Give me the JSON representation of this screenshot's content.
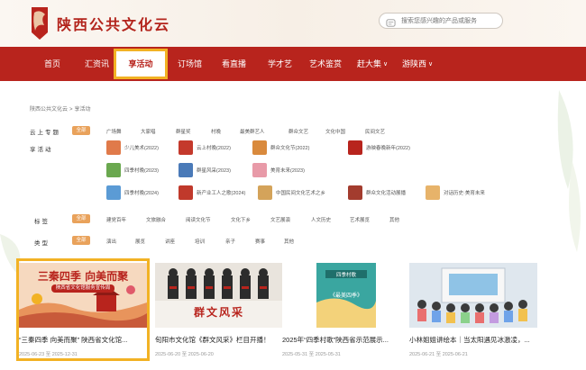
{
  "header": {
    "site_title": "陕西公共文化云",
    "logo_text": "陕西文化云",
    "search_placeholder": "搜索您感兴趣的产品或服务"
  },
  "nav": {
    "items": [
      {
        "label": "首页"
      },
      {
        "label": "汇资讯"
      },
      {
        "label": "享活动",
        "active": true
      },
      {
        "label": "订场馆"
      },
      {
        "label": "看直播"
      },
      {
        "label": "学才艺"
      },
      {
        "label": "艺术鉴赏"
      },
      {
        "label": "赶大集",
        "dropdown": true
      },
      {
        "label": "游陕西",
        "dropdown": true
      }
    ]
  },
  "breadcrumb": {
    "home": "陕西公共文化云",
    "sep": ">",
    "current": "享活动"
  },
  "filters": {
    "yunshang": {
      "label": "云上专题",
      "all": "全部",
      "options": [
        "广场舞",
        "大家唱",
        "群星奖",
        "村晚",
        "最美群艺人",
        "群众文艺",
        "文化中国",
        "民间文艺"
      ]
    },
    "xiang": {
      "label": "享活动",
      "activities": [
        {
          "label": "少儿美术(2022)",
          "color": "#e07a4a"
        },
        {
          "label": "云上村晚(2022)",
          "color": "#c4392c"
        },
        {
          "label": "群众文化节(2022)",
          "color": "#d98a3d"
        },
        {
          "label": "游映春晚新年(2022)",
          "color": "#b8241d"
        },
        {
          "label": "四季村晚(2023)",
          "color": "#6aa84f"
        },
        {
          "label": "群星风采(2023)",
          "color": "#4a7ab8"
        },
        {
          "label": "美育未来(2023)",
          "color": "#e89aa8"
        },
        {
          "label": "四季村晚(2024)",
          "color": "#5b9bd5"
        },
        {
          "label": "新产业工人之歌(2024)",
          "color": "#c0392b"
        },
        {
          "label": "中国民间文化艺术之乡",
          "color": "#d4a35a"
        },
        {
          "label": "群众文化活动展播",
          "color": "#a33c2e"
        },
        {
          "label": "对话历史·美育未来",
          "color": "#e7b36a"
        }
      ]
    },
    "tags": {
      "label": "标签",
      "all": "全部",
      "options": [
        "建党百年",
        "文旅融合",
        "阅读文化节",
        "文化下乡",
        "文艺展演",
        "人文历史",
        "艺术展览",
        "其他"
      ]
    },
    "types": {
      "label": "类型",
      "all": "全部",
      "options": [
        "演出",
        "展览",
        "讲座",
        "培训",
        "亲子",
        "赛事",
        "其他"
      ]
    }
  },
  "cards": [
    {
      "title": "“三秦四季 向美而聚” 陕西省文化馆...",
      "date": "2025-06-23 至 2025-12-31",
      "image_text": "三秦四季 向美而聚",
      "image_sub": "陕西省文化馆服务宣传周"
    },
    {
      "title": "旬阳市文化馆《群文风采》栏目开播！",
      "date": "2025-06-20 至 2025-06-20",
      "image_text": "群文风采"
    },
    {
      "title": "2025年“四季村歌”陕西省示范展示...",
      "date": "2025-05-31 至 2025-05-31",
      "image_text": "《最美四季》",
      "image_sub": "四季村歌"
    },
    {
      "title": "小林姐姐讲绘本｜当太阳遇见冰激凌，...",
      "date": "2025-06-21 至 2025-06-21"
    }
  ],
  "colors": {
    "brand": "#b8241d",
    "highlight": "#f2b224",
    "chip": "#e9a25b"
  }
}
